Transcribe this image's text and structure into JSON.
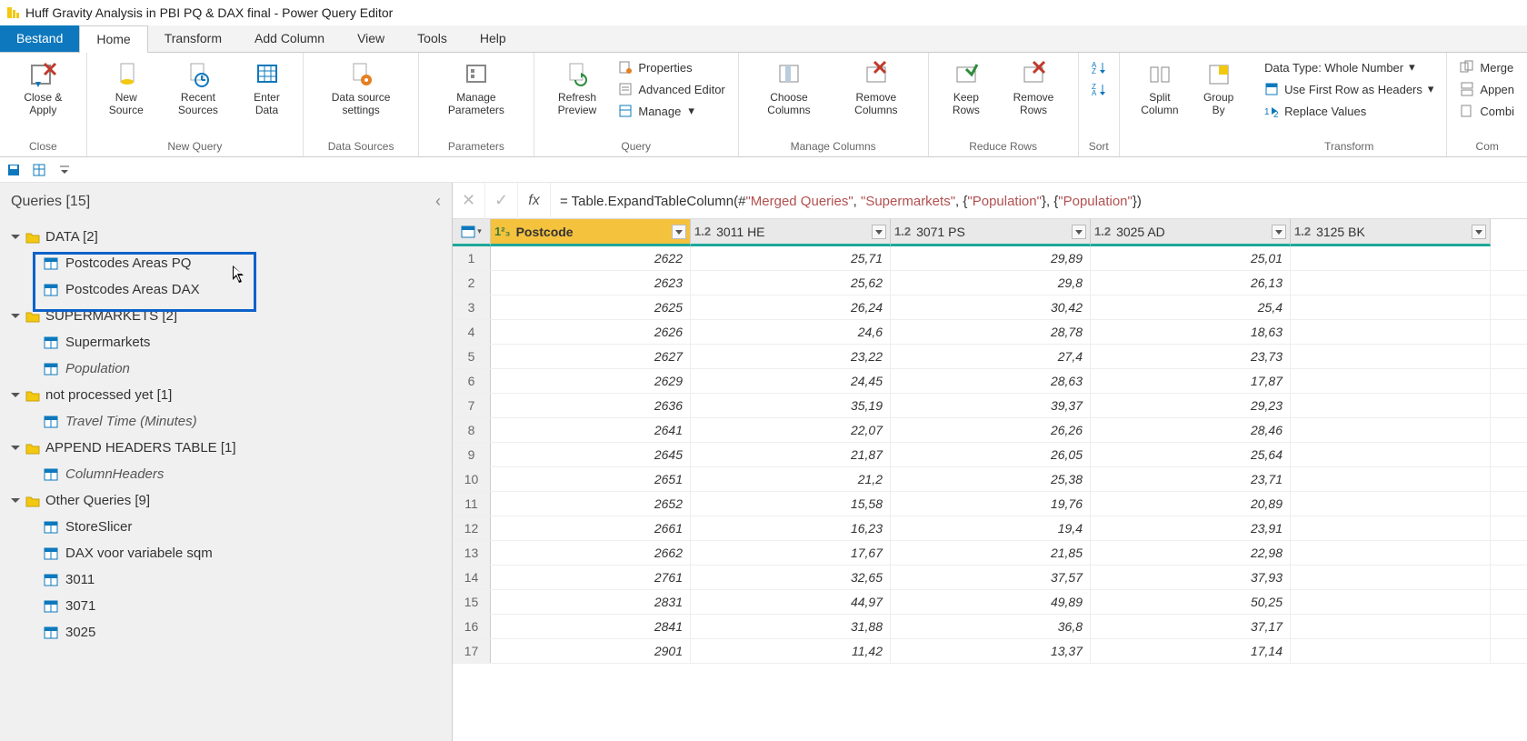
{
  "window_title": "Huff Gravity Analysis in PBI PQ & DAX final - Power Query Editor",
  "tabs": {
    "file": "Bestand",
    "home": "Home",
    "transform": "Transform",
    "addcol": "Add Column",
    "view": "View",
    "tools": "Tools",
    "help": "Help"
  },
  "ribbon": {
    "close": {
      "close_apply": "Close &\nApply",
      "group": "Close"
    },
    "newquery": {
      "new_source": "New\nSource",
      "recent_sources": "Recent\nSources",
      "enter_data": "Enter\nData",
      "group": "New Query"
    },
    "datasource": {
      "settings": "Data source\nsettings",
      "group": "Data Sources"
    },
    "params": {
      "manage": "Manage\nParameters",
      "group": "Parameters"
    },
    "query": {
      "refresh": "Refresh\nPreview",
      "properties": "Properties",
      "advanced": "Advanced Editor",
      "manage": "Manage",
      "group": "Query"
    },
    "managecolumns": {
      "choose": "Choose\nColumns",
      "remove": "Remove\nColumns",
      "group": "Manage Columns"
    },
    "reducerows": {
      "keep": "Keep\nRows",
      "remove": "Remove\nRows",
      "group": "Reduce Rows"
    },
    "sort": {
      "group": "Sort"
    },
    "split": {
      "split": "Split\nColumn",
      "groupby": "Group\nBy"
    },
    "transform": {
      "datatype": "Data Type: Whole Number",
      "firstrow": "Use First Row as Headers",
      "replace": "Replace Values",
      "group": "Transform"
    },
    "combine": {
      "merge": "Merge",
      "append": "Appen",
      "combine": "Combi",
      "group": "Com"
    }
  },
  "queries_header": "Queries [15]",
  "tree": [
    {
      "type": "folder",
      "label": "DATA [2]"
    },
    {
      "type": "item",
      "label": "Postcodes Areas PQ",
      "highlighted": true
    },
    {
      "type": "item",
      "label": "Postcodes Areas DAX",
      "highlighted": true
    },
    {
      "type": "folder",
      "label": "SUPERMARKETS [2]"
    },
    {
      "type": "item",
      "label": "Supermarkets"
    },
    {
      "type": "item",
      "label": "Population",
      "italic": true
    },
    {
      "type": "folder",
      "label": "not processed yet [1]"
    },
    {
      "type": "item",
      "label": "Travel Time (Minutes)",
      "italic": true
    },
    {
      "type": "folder",
      "label": "APPEND HEADERS TABLE [1]"
    },
    {
      "type": "item",
      "label": "ColumnHeaders",
      "italic": true
    },
    {
      "type": "folder",
      "label": "Other Queries [9]"
    },
    {
      "type": "item",
      "label": "StoreSlicer"
    },
    {
      "type": "item",
      "label": "DAX voor variabele sqm"
    },
    {
      "type": "item",
      "label": "3011"
    },
    {
      "type": "item",
      "label": "3071"
    },
    {
      "type": "item",
      "label": "3025"
    }
  ],
  "formula_prefix": "= Table.ExpandTableColumn(#",
  "formula_s1": "\"Merged Queries\"",
  "formula_mid1": ", ",
  "formula_s2": "\"Supermarkets\"",
  "formula_mid2": ", {",
  "formula_s3": "\"Population\"",
  "formula_mid3": "}, {",
  "formula_s4": "\"Population\"",
  "formula_suffix": "})",
  "columns": [
    {
      "type": "1²₃",
      "name": "Postcode",
      "sel": true
    },
    {
      "type": "1.2",
      "name": "3011 HE"
    },
    {
      "type": "1.2",
      "name": "3071 PS"
    },
    {
      "type": "1.2",
      "name": "3025 AD"
    },
    {
      "type": "1.2",
      "name": "3125 BK"
    }
  ],
  "rows": [
    [
      "2622",
      "25,71",
      "29,89",
      "25,01",
      ""
    ],
    [
      "2623",
      "25,62",
      "29,8",
      "26,13",
      ""
    ],
    [
      "2625",
      "26,24",
      "30,42",
      "25,4",
      ""
    ],
    [
      "2626",
      "24,6",
      "28,78",
      "18,63",
      ""
    ],
    [
      "2627",
      "23,22",
      "27,4",
      "23,73",
      ""
    ],
    [
      "2629",
      "24,45",
      "28,63",
      "17,87",
      ""
    ],
    [
      "2636",
      "35,19",
      "39,37",
      "29,23",
      ""
    ],
    [
      "2641",
      "22,07",
      "26,26",
      "28,46",
      ""
    ],
    [
      "2645",
      "21,87",
      "26,05",
      "25,64",
      ""
    ],
    [
      "2651",
      "21,2",
      "25,38",
      "23,71",
      ""
    ],
    [
      "2652",
      "15,58",
      "19,76",
      "20,89",
      ""
    ],
    [
      "2661",
      "16,23",
      "19,4",
      "23,91",
      ""
    ],
    [
      "2662",
      "17,67",
      "21,85",
      "22,98",
      ""
    ],
    [
      "2761",
      "32,65",
      "37,57",
      "37,93",
      ""
    ],
    [
      "2831",
      "44,97",
      "49,89",
      "50,25",
      ""
    ],
    [
      "2841",
      "31,88",
      "36,8",
      "37,17",
      ""
    ],
    [
      "2901",
      "11,42",
      "13,37",
      "17,14",
      ""
    ]
  ]
}
